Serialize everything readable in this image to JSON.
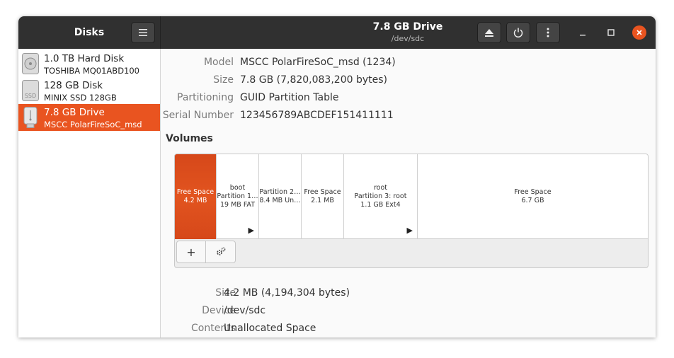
{
  "app": {
    "title": "Disks",
    "menu_icon": "hamburger-menu-icon"
  },
  "header": {
    "title": "7.8 GB Drive",
    "subtitle": "/dev/sdc",
    "buttons": [
      "eject-icon",
      "power-icon",
      "kebab-menu-icon"
    ],
    "window_controls": [
      "minimize-icon",
      "maximize-icon",
      "close-icon"
    ]
  },
  "sidebar": {
    "items": [
      {
        "name": "1.0 TB Hard Disk",
        "model": "TOSHIBA MQ01ABD100",
        "icon": "hard-disk-icon",
        "selected": false
      },
      {
        "name": "128 GB Disk",
        "model": "MINIX SSD 128GB",
        "icon": "ssd-icon",
        "icon_text": "SSD",
        "selected": false
      },
      {
        "name": "7.8 GB Drive",
        "model": "MSCC PolarFireSoC_msd",
        "icon": "usb-drive-icon",
        "selected": true
      }
    ]
  },
  "drive_info": [
    {
      "key": "Model",
      "value": "MSCC PolarFireSoC_msd (1234)"
    },
    {
      "key": "Size",
      "value": "7.8 GB (7,820,083,200 bytes)"
    },
    {
      "key": "Partitioning",
      "value": "GUID Partition Table"
    },
    {
      "key": "Serial Number",
      "value": "123456789ABCDEF151411111"
    }
  ],
  "volumes": {
    "heading": "Volumes",
    "segments": [
      {
        "lines": [
          "Free Space",
          "4.2 MB"
        ],
        "selected": true,
        "expander": false
      },
      {
        "lines": [
          "boot",
          "Partition 1…",
          "19 MB FAT"
        ],
        "selected": false,
        "expander": true
      },
      {
        "lines": [
          "Partition 2…",
          "8.4 MB Un…"
        ],
        "selected": false,
        "expander": false
      },
      {
        "lines": [
          "Free Space",
          "2.1 MB"
        ],
        "selected": false,
        "expander": false
      },
      {
        "lines": [
          "root",
          "Partition 3: root",
          "1.1 GB Ext4"
        ],
        "selected": false,
        "expander": true
      },
      {
        "lines": [
          "Free Space",
          "6.7 GB"
        ],
        "selected": false,
        "expander": false
      }
    ],
    "toolbar": {
      "add_label": "+",
      "settings_icon": "gears-icon"
    }
  },
  "volume_info": [
    {
      "key": "Size",
      "value": "4.2 MB (4,194,304 bytes)"
    },
    {
      "key": "Device",
      "value": "/dev/sdc"
    },
    {
      "key": "Contents",
      "value": "Unallocated Space"
    }
  ],
  "colors": {
    "accent": "#e95420",
    "titlebar": "#303030"
  }
}
